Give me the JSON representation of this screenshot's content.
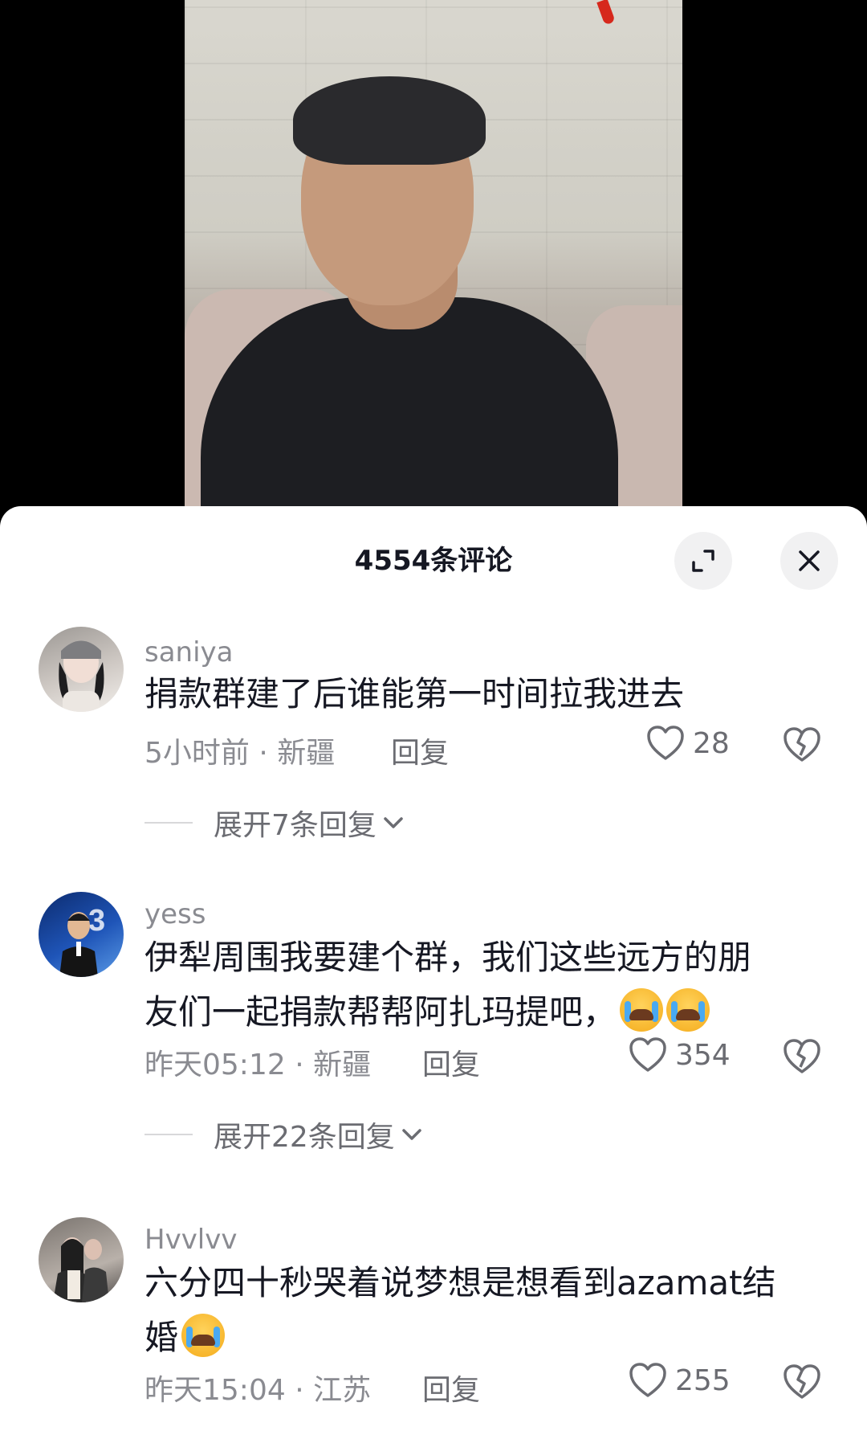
{
  "sheet": {
    "title": "4554条评论"
  },
  "comments": [
    {
      "username": "saniya",
      "text": "捐款群建了后谁能第一时间拉我进去",
      "meta": "5小时前 · 新疆",
      "reply_label": "回复",
      "likes": "28",
      "expand_label": "展开7条回复",
      "avatar_colors": [
        "#8e8a86",
        "#f0ece8"
      ]
    },
    {
      "username": "yess",
      "text_line1": "伊犁周围我要建个群，我们这些远方的朋",
      "text_line2": "友们一起捐款帮帮阿扎玛提吧，",
      "emojis": [
        "loudly-crying-face",
        "loudly-crying-face"
      ],
      "meta": "昨天05:12 · 新疆",
      "reply_label": "回复",
      "likes": "354",
      "expand_label": "展开22条回复",
      "avatar_colors": [
        "#1b3f8a",
        "#3a76d0"
      ]
    },
    {
      "username": "Hvvlvv",
      "text_line1": "六分四十秒哭着说梦想是想看到azamat结",
      "text_line2": "婚",
      "emojis": [
        "loudly-crying-face"
      ],
      "meta": "昨天15:04 · 江苏",
      "reply_label": "回复",
      "likes": "255",
      "avatar_colors": [
        "#6b6b6b",
        "#d9d4cf"
      ]
    }
  ],
  "icons": {
    "expand": "expand-icon",
    "close": "close-icon",
    "like": "heart-outline-icon",
    "dislike": "broken-heart-icon",
    "chevron": "chevron-down-icon"
  }
}
